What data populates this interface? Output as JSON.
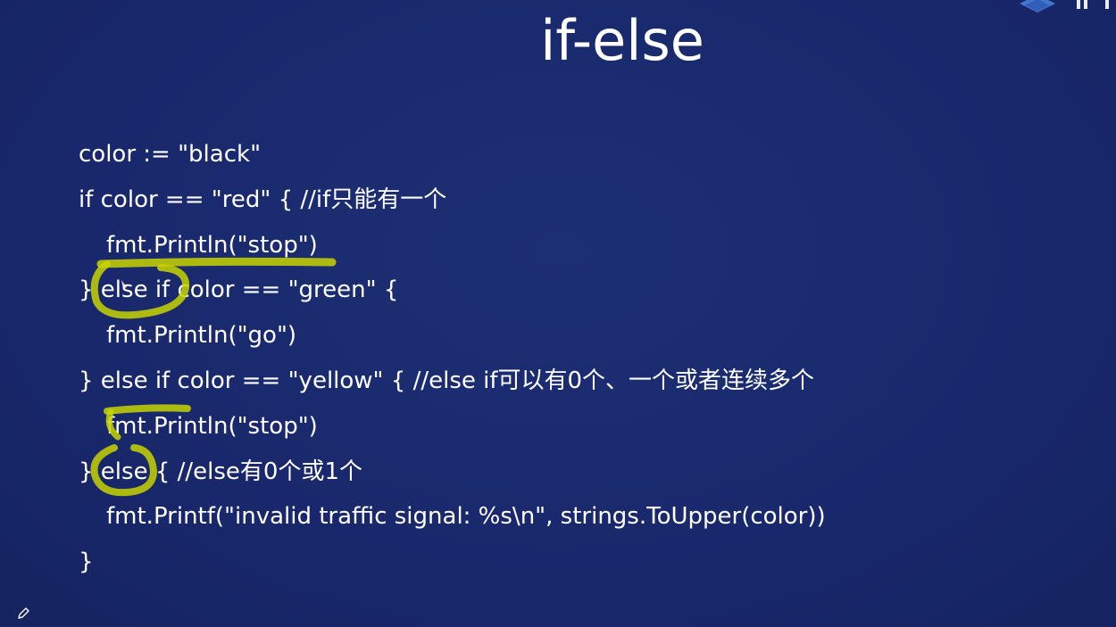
{
  "slide": {
    "title": "if-else",
    "code_lines": [
      "color := \"black\"",
      "if color == \"red\" { //if只能有一个",
      "fmt.Println(\"stop\")",
      "} else if color == \"green\" {",
      "fmt.Println(\"go\")",
      "} else if color == \"yellow\" { //else if可以有0个、一个或者连续多个",
      "fmt.Println(\"stop\")",
      "} else { //else有0个或1个",
      "fmt.Printf(\"invalid traffic signal: %s\\n\", strings.ToUpper(color))",
      "}"
    ]
  },
  "colors": {
    "background": "#1a2a6c",
    "text": "#ffffff",
    "annotation": "#c8d400"
  },
  "icons": {
    "logo": "brand-logo-icon",
    "pen": "pen-icon"
  }
}
